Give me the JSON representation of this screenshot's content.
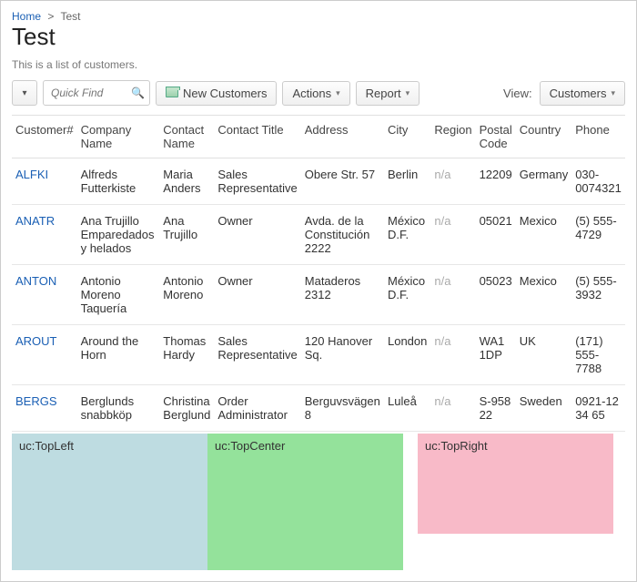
{
  "breadcrumb": {
    "home": "Home",
    "current": "Test"
  },
  "page": {
    "title": "Test",
    "description": "This is a list of customers."
  },
  "toolbar": {
    "quick_find_placeholder": "Quick Find",
    "new_label": "New Customers",
    "actions_label": "Actions",
    "report_label": "Report",
    "view_label": "View:",
    "view_value": "Customers"
  },
  "columns": {
    "c0": "Customer#",
    "c1": "Company Name",
    "c2": "Contact Name",
    "c3": "Contact Title",
    "c4": "Address",
    "c5": "City",
    "c6": "Region",
    "c7": "Postal Code",
    "c8": "Country",
    "c9": "Phone"
  },
  "rows": [
    {
      "id": "ALFKI",
      "company": "Alfreds Futterkiste",
      "contact": "Maria Anders",
      "title": "Sales Representative",
      "address": "Obere Str. 57",
      "city": "Berlin",
      "region": "n/a",
      "postal": "12209",
      "country": "Germany",
      "phone": "030-0074321"
    },
    {
      "id": "ANATR",
      "company": "Ana Trujillo Emparedados y helados",
      "contact": "Ana Trujillo",
      "title": "Owner",
      "address": "Avda. de la Constitución 2222",
      "city": "México D.F.",
      "region": "n/a",
      "postal": "05021",
      "country": "Mexico",
      "phone": "(5) 555-4729"
    },
    {
      "id": "ANTON",
      "company": "Antonio Moreno Taquería",
      "contact": "Antonio Moreno",
      "title": "Owner",
      "address": "Mataderos 2312",
      "city": "México D.F.",
      "region": "n/a",
      "postal": "05023",
      "country": "Mexico",
      "phone": "(5) 555-3932"
    },
    {
      "id": "AROUT",
      "company": "Around the Horn",
      "contact": "Thomas Hardy",
      "title": "Sales Representative",
      "address": "120 Hanover Sq.",
      "city": "London",
      "region": "n/a",
      "postal": "WA1 1DP",
      "country": "UK",
      "phone": "(171) 555-7788"
    },
    {
      "id": "BERGS",
      "company": "Berglunds snabbköp",
      "contact": "Christina Berglund",
      "title": "Order Administrator",
      "address": "Berguvsvägen 8",
      "city": "Luleå",
      "region": "n/a",
      "postal": "S-958 22",
      "country": "Sweden",
      "phone": "0921-12 34 65"
    }
  ],
  "panels": {
    "left": "uc:TopLeft",
    "center": "uc:TopCenter",
    "right": "uc:TopRight"
  }
}
